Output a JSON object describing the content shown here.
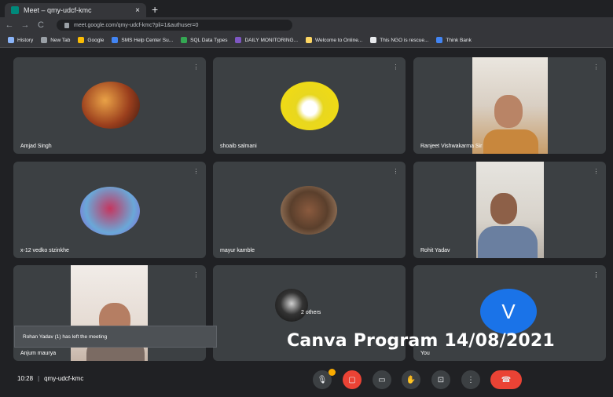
{
  "browser": {
    "tab_title": "Meet – qmy-udcf-kmc",
    "tab_close": "×",
    "new_tab": "+",
    "back": "←",
    "forward": "→",
    "reload": "C",
    "url": "meet.google.com/qmy-udcf-kmc?pli=1&authuser=0",
    "bookmarks": [
      {
        "label": "History",
        "color": "#8ab4f8"
      },
      {
        "label": "New Tab",
        "color": "#9aa0a6"
      },
      {
        "label": "Google",
        "color": "#fbbc04"
      },
      {
        "label": "SMS Help Center Su...",
        "color": "#4285f4"
      },
      {
        "label": "SQL Data Types",
        "color": "#34a853"
      },
      {
        "label": "DAILY MONITORING...",
        "color": "#7e57c2"
      },
      {
        "label": "Welcome to Online...",
        "color": "#fdd663"
      },
      {
        "label": "This NGO is rescue...",
        "color": "#e8eaed"
      },
      {
        "label": "Think Bank",
        "color": "#4285f4"
      }
    ]
  },
  "participants": [
    {
      "name": "Amjad Singh",
      "mic": "⋮"
    },
    {
      "name": "shoaib salmani",
      "mic": "⋮"
    },
    {
      "name": "Ranjeet Vishwakarma Sir",
      "mic": "⋮"
    },
    {
      "name": "x-12 vedko stzinkhe",
      "mic": "⋮"
    },
    {
      "name": "mayur kamble",
      "mic": "⋮"
    },
    {
      "name": "Rohit Yadav",
      "mic": "⋮"
    },
    {
      "name": "Anjum maurya",
      "mic": "⋮"
    },
    {
      "name": "2 others",
      "mic": "⋮"
    },
    {
      "name": "You",
      "mic": "⋮",
      "initial": "V"
    }
  ],
  "notification": "Rohan Yadav (1) has left the meeting",
  "overlay_text": "Canva Program 14/08/2021",
  "bottom_bar": {
    "time": "10:28",
    "separator": "|",
    "meeting_code": "qmy-udcf-kmc"
  },
  "controls": [
    {
      "name": "mic-button",
      "glyph": "🎙",
      "icon": "mic-off-icon"
    },
    {
      "name": "camera-button",
      "glyph": "▢",
      "icon": "camera-off-icon"
    },
    {
      "name": "captions-button",
      "glyph": "▭",
      "icon": "captions-icon"
    },
    {
      "name": "raise-hand-button",
      "glyph": "✋",
      "icon": "hand-icon"
    },
    {
      "name": "present-button",
      "glyph": "⊡",
      "icon": "present-icon"
    },
    {
      "name": "more-options-button",
      "glyph": "⋮",
      "icon": "more-icon"
    },
    {
      "name": "leave-call-button",
      "glyph": "☎",
      "icon": "hang-up-icon"
    }
  ],
  "colors": {
    "background": "#202124",
    "tile": "#3c4043",
    "danger": "#ea4335",
    "you_avatar": "#1a73e8"
  }
}
